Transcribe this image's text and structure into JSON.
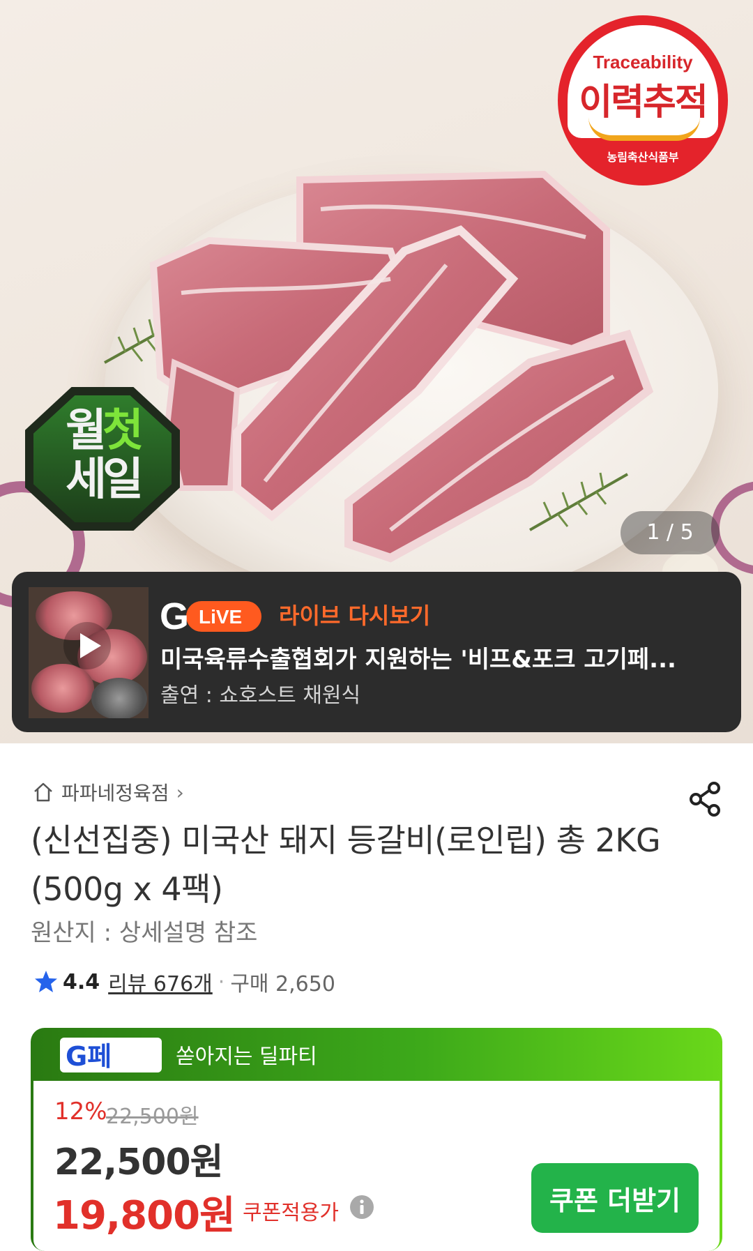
{
  "hero": {
    "trace_badge": {
      "en": "Traceability",
      "ko": "이력추적",
      "ministry": "농림축산식품부"
    },
    "sale_badge": {
      "line1_a": "월",
      "line1_b": "첫",
      "line2": "세일"
    },
    "image_counter": "1 / 5"
  },
  "live_banner": {
    "logo_g": "G",
    "logo_live": "LiVE",
    "title": "라이브 다시보기",
    "description": "미국육류수출협회가 지원하는 '비프&포크 고기페...",
    "host": "출연 : 쇼호스트 채원식"
  },
  "product": {
    "store_name": "파파네정육점",
    "title": "(신선집중) 미국산 돼지 등갈비(로인립) 총 2KG (500g x 4팩)",
    "origin": "원산지 : 상세설명 참조",
    "rating": "4.4",
    "review_label": "리뷰 676개",
    "purchase_label": "구매 2,650"
  },
  "deal": {
    "logo_text": "G페",
    "title": "쏟아지는 딜파티",
    "discount_rate": "12%",
    "original_price": "22,500원",
    "price": "22,500원",
    "coupon_price": "19,800원",
    "coupon_label": "쿠폰적용가",
    "coupon_button": "쿠폰 더받기"
  },
  "colors": {
    "accent_red": "#e1302a",
    "live_orange": "#ff6a2b",
    "deal_green": "#3ca81a",
    "button_green": "#23b34a"
  },
  "icons": [
    "home-icon",
    "chevron-right-icon",
    "share-icon",
    "star-icon",
    "play-icon",
    "info-icon"
  ]
}
